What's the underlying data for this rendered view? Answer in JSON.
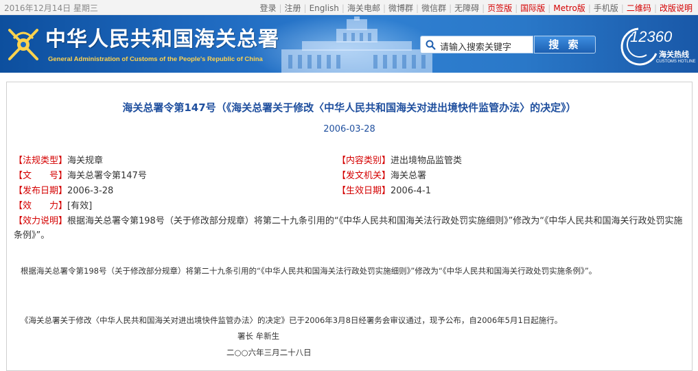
{
  "topbar": {
    "date": "2016年12月14日 星期三",
    "links": [
      {
        "label": "登录",
        "red": false
      },
      {
        "label": "注册",
        "red": false
      },
      {
        "label": "English",
        "red": false
      },
      {
        "label": "海关电邮",
        "red": false
      },
      {
        "label": "微博群",
        "red": false
      },
      {
        "label": "微信群",
        "red": false
      },
      {
        "label": "无障碍",
        "red": false
      },
      {
        "label": "页签版",
        "red": true
      },
      {
        "label": "国际版",
        "red": true
      },
      {
        "label": "Metro版",
        "red": true
      },
      {
        "label": "手机版",
        "red": false
      },
      {
        "label": "二维码",
        "red": true
      },
      {
        "label": "改版说明",
        "red": true
      }
    ]
  },
  "header": {
    "title_cn": "中华人民共和国海关总署",
    "title_en": "General Administration of Customs of the People's Republic of China",
    "search_placeholder": "请输入搜索关键字",
    "search_button": "搜 索",
    "hotline_number": "12360",
    "hotline_cn": "海关热线",
    "hotline_en": "CUSTOMS HOTLINE"
  },
  "article": {
    "title": "海关总署令第147号（《海关总署关于修改〈中华人民共和国海关对进出境快件监管办法〉的决定》）",
    "date": "2006-03-28",
    "meta": {
      "type_label": "【法规类型】",
      "type_value": "海关规章",
      "category_label": "【内容类别】",
      "category_value": "进出境物品监管类",
      "docno_label": "【文　　号】",
      "docno_value": "海关总署令第147号",
      "issuer_label": "【发文机关】",
      "issuer_value": "海关总署",
      "issued_label": "【发布日期】",
      "issued_value": "2006-3-28",
      "effective_label": "【生效日期】",
      "effective_value": "2006-4-1",
      "validity_label": "【效　　力】",
      "validity_value": "[有效]",
      "note_label": "【效力说明】",
      "note_value": "根据海关总署令第198号（关于修改部分规章）将第二十九条引用的“《中华人民共和国海关法行政处罚实施细则》”修改为“《中华人民共和国海关行政处罚实施条例》”。"
    },
    "body": {
      "p1": "根据海关总署令第198号（关于修改部分规章）将第二十九条引用的“《中华人民共和国海关法行政处罚实施细则》”修改为“《中华人民共和国海关行政处罚实施条例》”。",
      "p2": "《海关总署关于修改〈中华人民共和国海关对进出境快件监管办法〉的决定》已于2006年3月8日经署务会审议通过，现予公布，自2006年5月1日起施行。",
      "signer": "署长 牟新生",
      "sign_date": "二○○六年三月二十八日"
    }
  },
  "colors": {
    "link_blue": "#1f4f9e",
    "label_red": "#d40000",
    "banner_blue": "#1f6ac0",
    "en_title_gold": "#ffd34d"
  }
}
